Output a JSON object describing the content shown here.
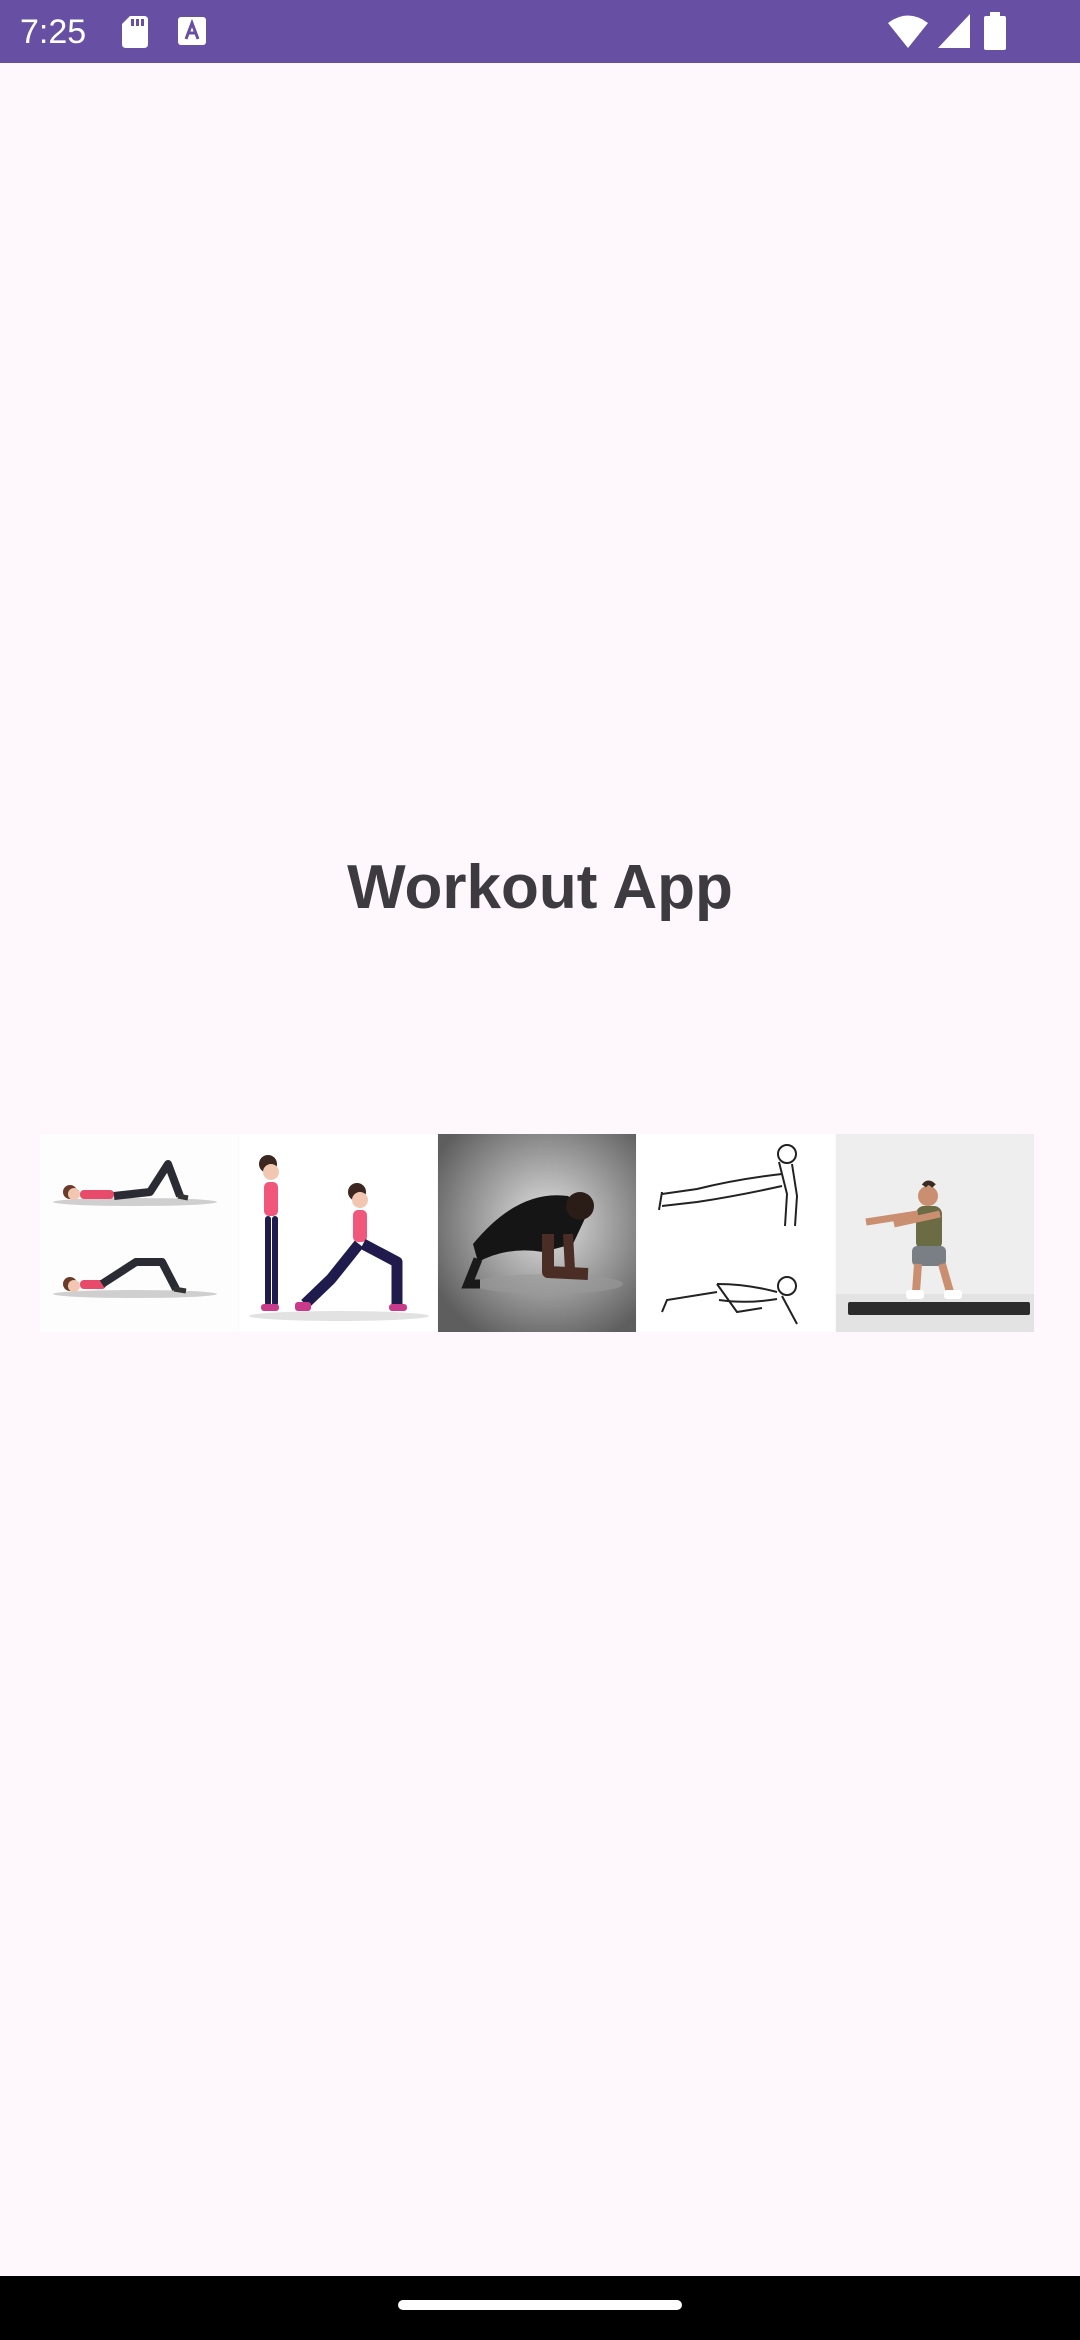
{
  "status_bar": {
    "time": "7:25",
    "background": "#6750a4",
    "icons": [
      "sd-card-icon",
      "text-a-icon",
      "wifi-icon",
      "signal-icon",
      "battery-icon"
    ]
  },
  "title": "Workout App",
  "exercise_images": [
    {
      "name": "glute-bridge-image"
    },
    {
      "name": "lunge-image"
    },
    {
      "name": "plank-image"
    },
    {
      "name": "pushup-image"
    },
    {
      "name": "squat-image"
    }
  ],
  "colors": {
    "background": "#fef7fc",
    "title_text": "#3d3b40",
    "accent": "#6750a4"
  }
}
